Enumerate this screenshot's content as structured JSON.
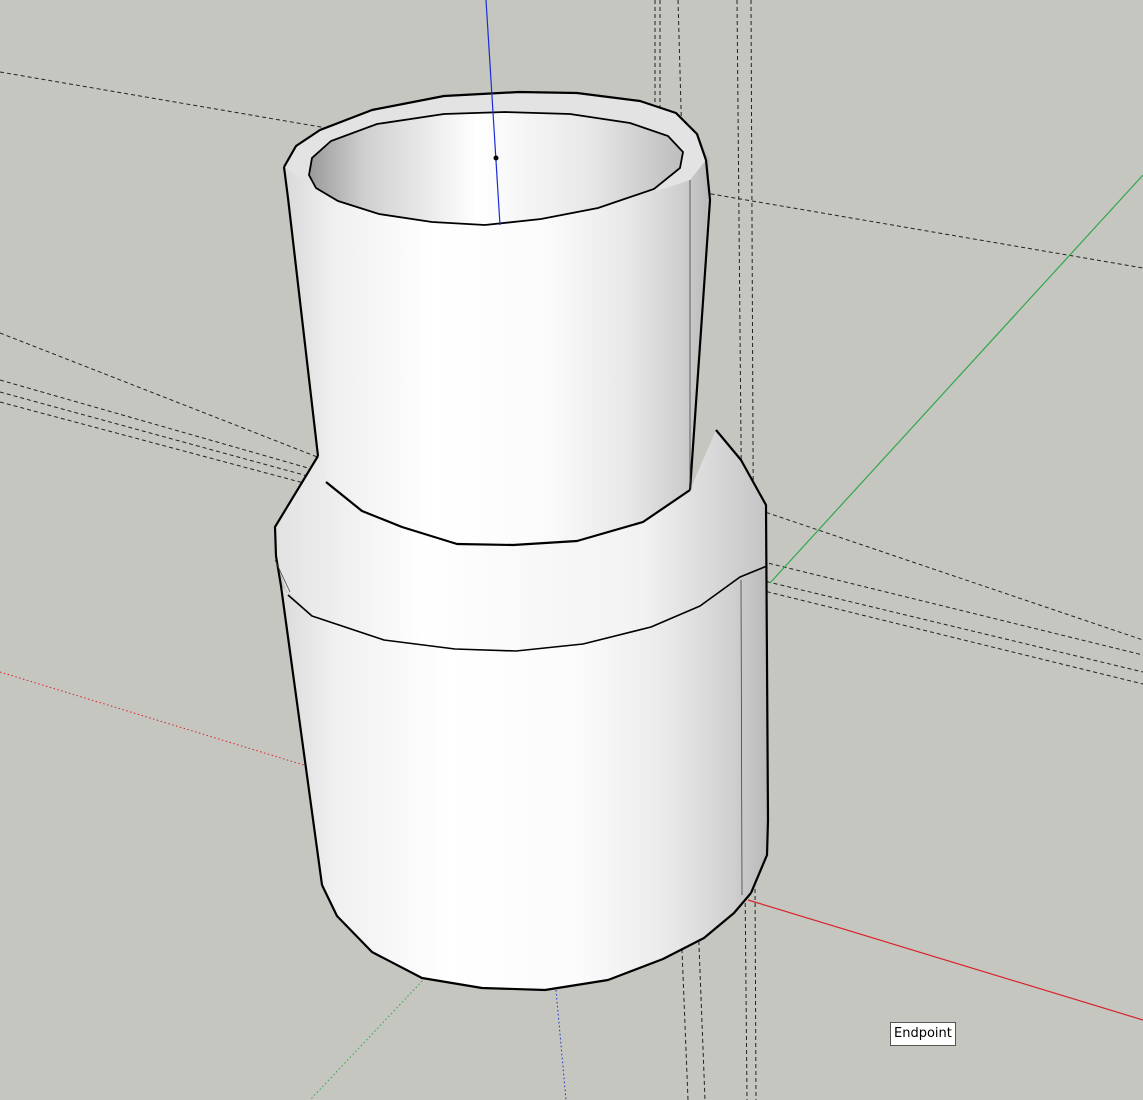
{
  "viewport": {
    "background_color": "#c6c6c0",
    "axis_colors": {
      "red": "#d8232a",
      "green": "#2fa84a",
      "blue": "#1b2bd6"
    },
    "guide_color": "#222222",
    "model_fill": "#ffffff",
    "model_edge": "#000000"
  },
  "tooltip": {
    "text": "Endpoint"
  },
  "scene_objects": [
    "model",
    "red-axis",
    "green-axis",
    "blue-axis",
    "guide-lines",
    "inference-point"
  ]
}
